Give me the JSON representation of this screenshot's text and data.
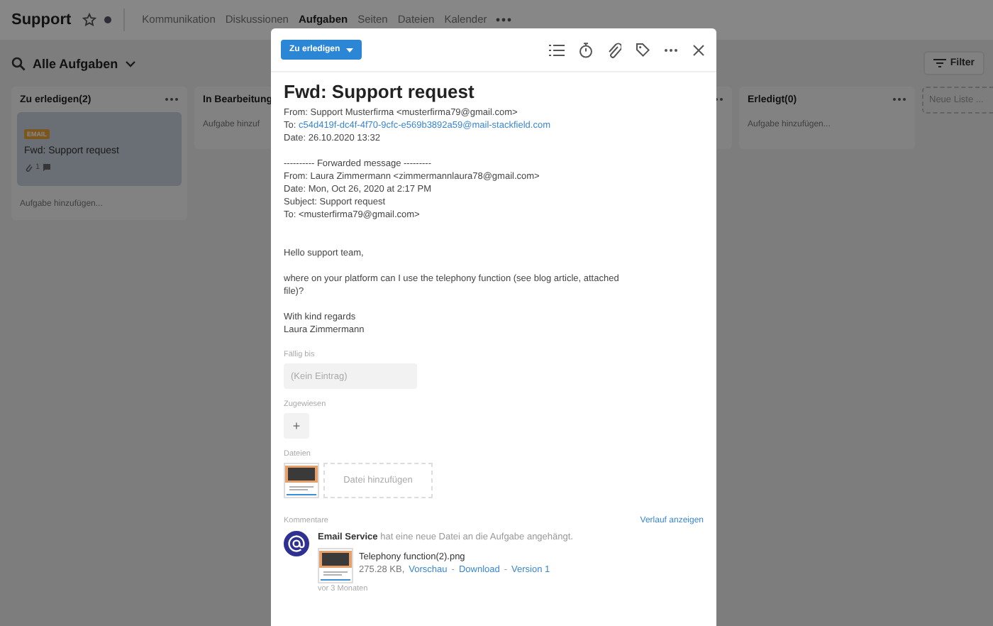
{
  "header": {
    "title": "Support",
    "tabs": [
      {
        "label": "Kommunikation",
        "selected": false
      },
      {
        "label": "Diskussionen",
        "selected": false
      },
      {
        "label": "Aufgaben",
        "selected": true
      },
      {
        "label": "Seiten",
        "selected": false
      },
      {
        "label": "Dateien",
        "selected": false
      },
      {
        "label": "Kalender",
        "selected": false
      }
    ]
  },
  "toolbar": {
    "view": "Alle Aufgaben",
    "filter": "Filter"
  },
  "lists": [
    {
      "title": "Zu erledigen(2)",
      "cards": [
        {
          "tag": "EMAIL",
          "title": "Fwd: Support request",
          "attachments": "1"
        }
      ],
      "add_label": "Aufgabe hinzufügen..."
    },
    {
      "title": "In Bearbeitung",
      "add_label": "Aufgabe hinzuf"
    },
    {
      "title": "Erledigt(0)",
      "add_label": "Aufgabe hinzufügen..."
    }
  ],
  "new_list": "Neue Liste ...",
  "task": {
    "status": "Zu erledigen",
    "title": "Fwd: Support request",
    "header_lines": [
      {
        "label": "From:",
        "value": "Support Musterfirma <musterfirma79@gmail.com>",
        "link": false
      },
      {
        "label": "To:",
        "value": "c54d419f-dc4f-4f70-9cfc-e569b3892a59@mail-stackfield.com",
        "link": true
      },
      {
        "label": "Date:",
        "value": "26.10.2020 13:32",
        "link": false
      }
    ],
    "forwarded": "---------- Forwarded message ---------",
    "forwarded_lines": [
      {
        "label": "From:",
        "value": "Laura Zimmermann <zimmermannlaura78@gmail.com>",
        "link": false
      },
      {
        "label": "Date:",
        "value": "Mon, Oct 26, 2020 at 2:17 PM",
        "link": false
      },
      {
        "label": "Subject:",
        "value": "Support request",
        "link": false
      },
      {
        "label": "To:",
        "value": "<musterfirma79@gmail.com>",
        "link": false
      }
    ],
    "body": [
      "Hello support team,",
      "where on your platform can I use the telephony function (see blog article, attached file)?",
      "With kind regards\nLaura Zimmermann"
    ],
    "due_label": "Fällig bis",
    "due_placeholder": "(Kein Eintrag)",
    "assigned_label": "Zugewiesen",
    "assign_button": "+",
    "files_label": "Dateien",
    "add_file": "Datei hinzufügen",
    "comments_label": "Kommentare",
    "history_link": "Verlauf anzeigen",
    "comment": {
      "author": "Email Service",
      "text": "hat eine neue Datei an die Aufgabe angehängt.",
      "file_name": "Telephony function(2).png",
      "file_size": "275.28 KB,",
      "links": [
        "Vorschau",
        "Download",
        "Version 1"
      ],
      "link_separator": "-",
      "time": "vor 3 Monaten"
    }
  }
}
